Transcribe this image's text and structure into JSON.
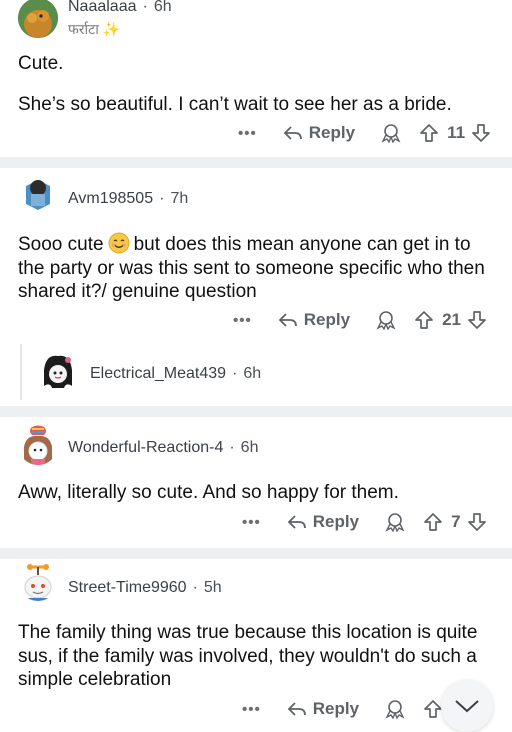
{
  "comments": [
    {
      "username": "Naaalaaa",
      "time": "6h",
      "flair_text": "फर्राटा",
      "flair_icon": "sparkles-icon",
      "body": [
        "Cute.",
        "She’s so beautiful. I can’t wait to see her as a bride."
      ],
      "reply_label": "Reply",
      "score": "11"
    },
    {
      "username": "Avm198505",
      "time": "7h",
      "body_part1": "Sooo cute",
      "body_emoji": "smiling-face-emoji",
      "body_part2": "but does this mean anyone can get in to the party or was this sent to someone specific who then shared it?/ genuine question",
      "reply_label": "Reply",
      "score": "21"
    },
    {
      "username": "Electrical_Meat439",
      "time": "6h"
    },
    {
      "username": "Wonderful-Reaction-4",
      "time": "6h",
      "body": "Aww, literally so cute. And so happy for them.",
      "reply_label": "Reply",
      "score": "7"
    },
    {
      "username": "Street-Time9960",
      "time": "5h",
      "body": "The family thing was true because this location is quite sus, if the family was involved, they wouldn't do such a simple celebration",
      "reply_label": "Reply"
    }
  ],
  "icons": {
    "more": "more-options-icon",
    "reply": "reply-arrow-icon",
    "award": "award-icon",
    "upvote": "upvote-arrow-icon",
    "downvote": "downvote-arrow-icon",
    "scroll": "chevron-down-icon"
  },
  "colors": {
    "separator": "#edeff1",
    "text": "#1a1a1b",
    "meta": "#4a4f54"
  }
}
